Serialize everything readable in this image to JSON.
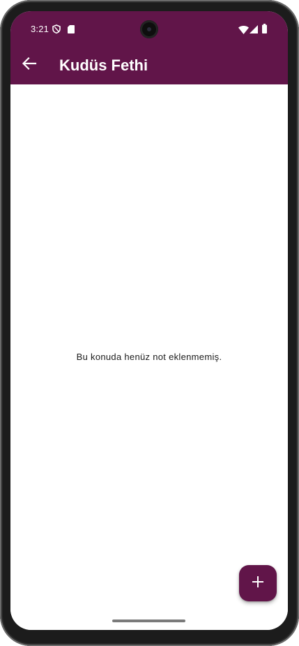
{
  "status_bar": {
    "time": "3:21",
    "icons": [
      "shield-icon",
      "sd-card-icon",
      "wifi-icon",
      "signal-icon",
      "battery-icon"
    ]
  },
  "toolbar": {
    "back_icon": "arrow-back-icon",
    "title": "Kudüs Fethi"
  },
  "main": {
    "empty_message": "Bu konuda henüz not eklenmemiş."
  },
  "fab": {
    "icon": "plus-icon"
  },
  "colors": {
    "primary": "#611549",
    "on_primary": "#ffffff",
    "background": "#ffffff",
    "text": "#1b1b1b"
  }
}
